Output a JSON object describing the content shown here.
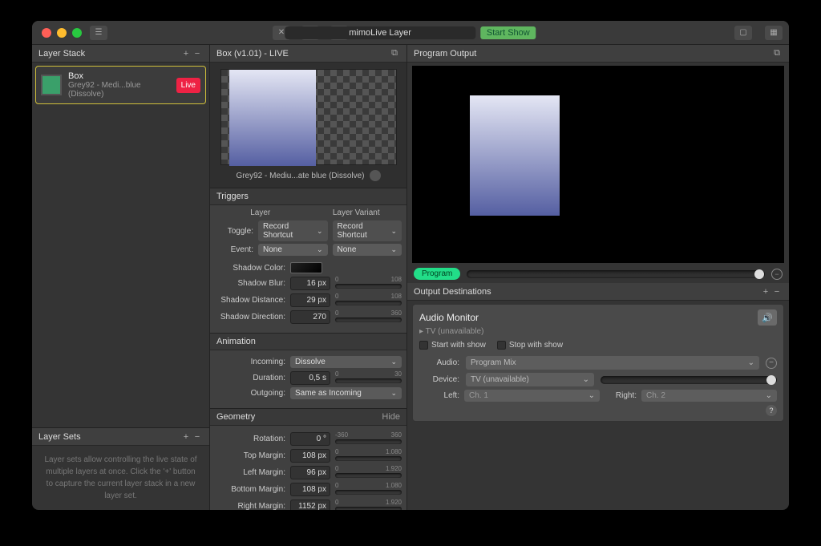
{
  "titlebar": {
    "doc_title": "mimoLive Layer",
    "start_show": "Start Show"
  },
  "left": {
    "header": "Layer Stack",
    "layer": {
      "title": "Box",
      "subtitle": "Grey92 - Medi...blue (Dissolve)",
      "badge": "Live"
    },
    "layersets": {
      "header": "Layer Sets",
      "body": "Layer sets allow controlling the live state of multiple layers at once. Click the '+' button to capture the current layer stack in a new layer set."
    }
  },
  "mid": {
    "header": "Box (v1.01) - LIVE",
    "preview_caption": "Grey92 - Mediu...ate blue (Dissolve)",
    "triggers": {
      "header": "Triggers",
      "col_layer": "Layer",
      "col_variant": "Layer Variant",
      "toggle_label": "Toggle:",
      "toggle_val": "Record Shortcut",
      "toggle_val2": "Record Shortcut",
      "event_label": "Event:",
      "event_val": "None",
      "event_val2": "None"
    },
    "shadow": {
      "color_label": "Shadow Color:",
      "blur_label": "Shadow Blur:",
      "blur_val": "16 px",
      "blur_min": "0",
      "blur_max": "108",
      "dist_label": "Shadow Distance:",
      "dist_val": "29 px",
      "dist_min": "0",
      "dist_max": "108",
      "dir_label": "Shadow Direction:",
      "dir_val": "270",
      "dir_min": "0",
      "dir_max": "360"
    },
    "animation": {
      "header": "Animation",
      "incoming_label": "Incoming:",
      "incoming_val": "Dissolve",
      "duration_label": "Duration:",
      "duration_val": "0,5 s",
      "duration_min": "0",
      "duration_max": "30",
      "outgoing_label": "Outgoing:",
      "outgoing_val": "Same as Incoming"
    },
    "geometry": {
      "header": "Geometry",
      "hide": "Hide",
      "rotation_label": "Rotation:",
      "rotation_val": "0 °",
      "rotation_min": "-360",
      "rotation_max": "360",
      "top_label": "Top Margin:",
      "top_val": "108 px",
      "top_min": "0",
      "top_max": "1.080",
      "left_label": "Left Margin:",
      "left_val": "96 px",
      "left_min": "0",
      "left_max": "1.920",
      "bottom_label": "Bottom Margin:",
      "bottom_val": "108 px",
      "bottom_min": "0",
      "bottom_max": "1.080",
      "right_label": "Right Margin:",
      "right_val": "1152 px",
      "right_min": "0",
      "right_max": "1.920"
    }
  },
  "right": {
    "prog_header": "Program Output",
    "program_pill": "Program",
    "outdest_header": "Output Destinations",
    "audio": {
      "title": "Audio Monitor",
      "subtitle": "TV (unavailable)",
      "start": "Start with show",
      "stop": "Stop with show",
      "audio_label": "Audio:",
      "audio_val": "Program Mix",
      "device_label": "Device:",
      "device_val": "TV (unavailable)",
      "left_label": "Left:",
      "left_val": "Ch. 1",
      "right_label": "Right:",
      "right_val": "Ch. 2"
    }
  }
}
